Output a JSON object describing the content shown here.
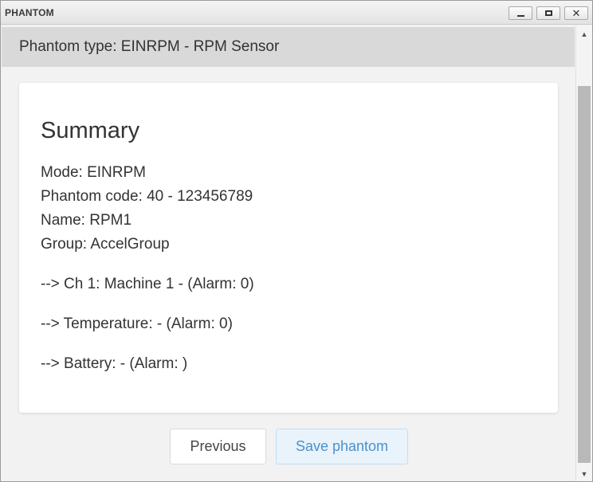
{
  "window": {
    "title": "PHANTOM",
    "minimize_icon": "minimize-icon",
    "maximize_icon": "maximize-icon",
    "close_icon": "close-icon",
    "close_glyph": "✕"
  },
  "header": {
    "phantom_type": "Phantom type: EINRPM - RPM Sensor"
  },
  "summary": {
    "title": "Summary",
    "mode": "Mode: EINRPM",
    "phantom_code": "Phantom code: 40 - 123456789",
    "name": "Name: RPM1",
    "group": "Group: AccelGroup",
    "channel": "--> Ch 1: Machine 1 - (Alarm: 0)",
    "temperature": "--> Temperature: - (Alarm: 0)",
    "battery": "--> Battery: - (Alarm: )"
  },
  "actions": {
    "previous_label": "Previous",
    "save_label": "Save phantom"
  },
  "scrollbar": {
    "up_glyph": "▲",
    "down_glyph": "▼"
  },
  "colors": {
    "header_bg": "#d9d9d9",
    "save_text": "#4d90c9",
    "save_bg": "#e8f3fc"
  }
}
